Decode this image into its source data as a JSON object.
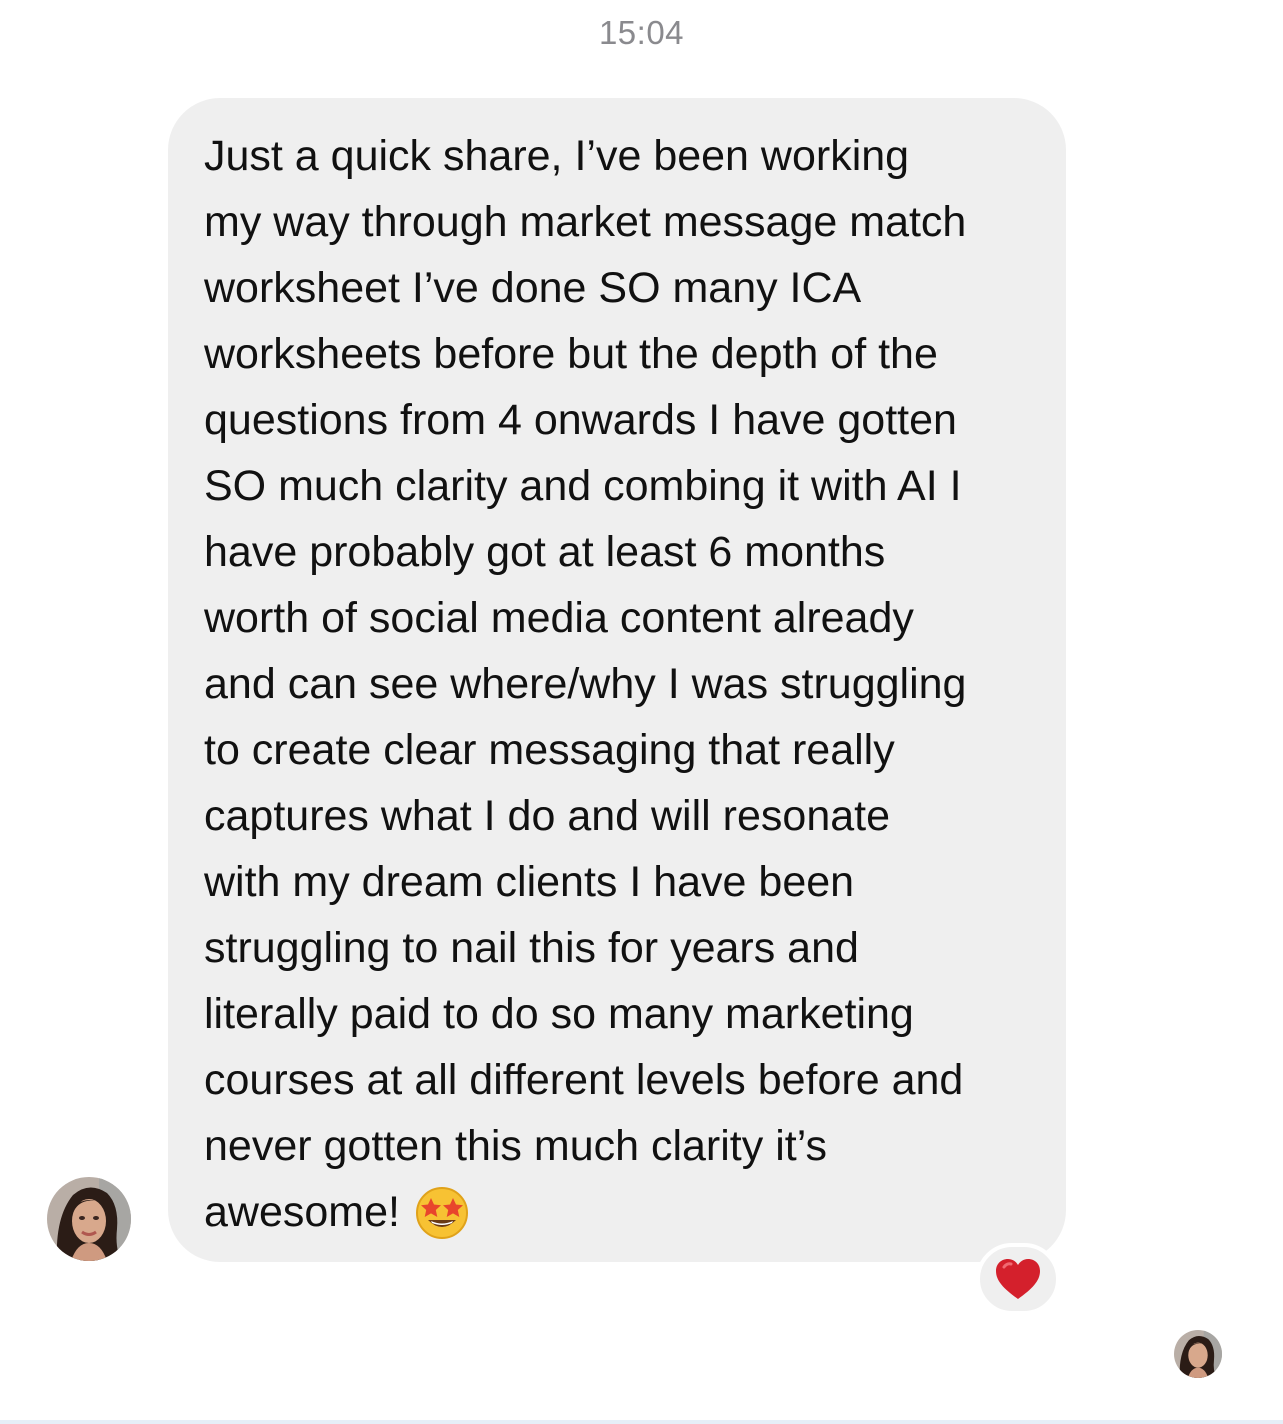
{
  "conversation": {
    "timestamp": "15:04",
    "message": {
      "lines": [
        "Just a quick share, I’ve been working",
        "my way through market message match",
        "worksheet I’ve done SO many ICA",
        "worksheets before but the depth of the",
        "questions from 4 onwards I have gotten",
        "SO much clarity and combing it with AI I",
        "have probably got at least 6 months",
        "worth of social media content already",
        "and can see where/why I was struggling",
        "to create clear messaging that really",
        "captures what I do and will resonate",
        "with my dream clients I have been",
        "struggling to nail this for years and",
        "literally paid to do so many marketing",
        "courses at all different levels before and",
        "never gotten this much clarity it’s",
        "awesome!"
      ],
      "trailing_emoji": "star-struck-emoji",
      "reaction": "red-heart-icon"
    },
    "sender_avatar": "avatar-photo",
    "read_receipt_avatar": "avatar-photo"
  },
  "colors": {
    "bubble": "#efefef",
    "timestamp": "#8a8a8e",
    "text": "#111111",
    "heart": "#d4202c",
    "emoji_face": "#f7c233"
  }
}
